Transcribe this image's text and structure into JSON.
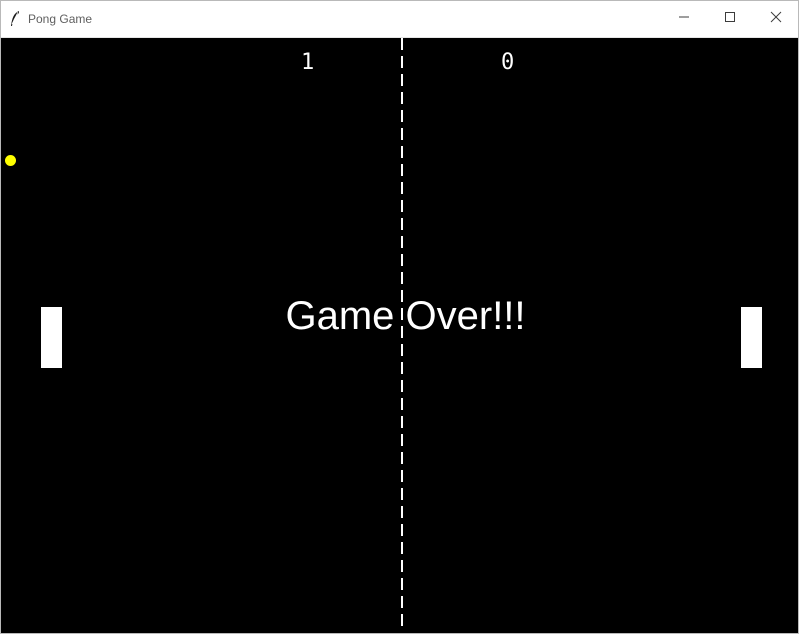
{
  "window": {
    "title": "Pong Game",
    "icon": "feather-icon",
    "controls": [
      "minimize-icon",
      "maximize-icon",
      "close-icon"
    ]
  },
  "game": {
    "background_color": "#000000",
    "score_left": "1",
    "score_right": "0",
    "message": "Game Over!!!",
    "ball_color": "#ffff00",
    "paddle_color": "#ffffff",
    "center_line": "dashed"
  }
}
